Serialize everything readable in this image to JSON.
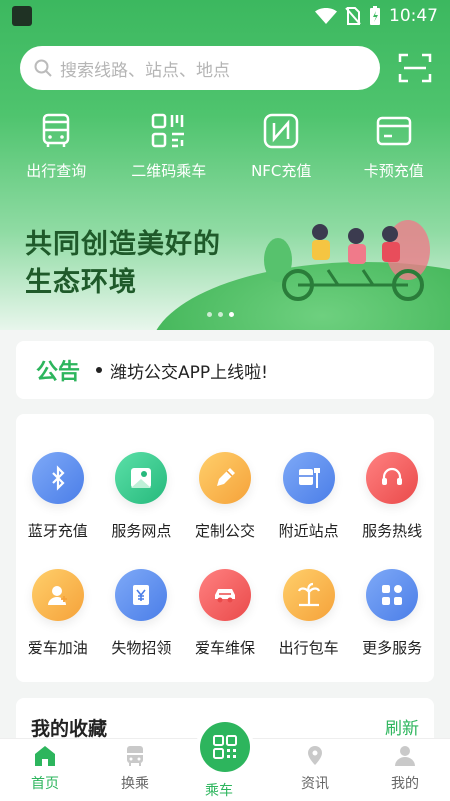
{
  "status": {
    "time": "10:47"
  },
  "search": {
    "placeholder": "搜索线路、站点、地点"
  },
  "quick": [
    {
      "label": "出行查询",
      "icon": "bus-icon"
    },
    {
      "label": "二维码乘车",
      "icon": "qrcode-icon"
    },
    {
      "label": "NFC充值",
      "icon": "nfc-icon"
    },
    {
      "label": "卡预充值",
      "icon": "card-icon"
    }
  ],
  "banner": {
    "line1": "共同创造美好的",
    "line2": "生态环境"
  },
  "notice": {
    "tag": "公告",
    "text": "潍坊公交APP上线啦!"
  },
  "services": [
    {
      "label": "蓝牙充值",
      "icon": "bluetooth-icon",
      "color": "#5b8ff0"
    },
    {
      "label": "服务网点",
      "icon": "map-pin-icon",
      "color": "#37c98c"
    },
    {
      "label": "定制公交",
      "icon": "pencil-icon",
      "color": "#f7b347"
    },
    {
      "label": "附近站点",
      "icon": "bus-stop-icon",
      "color": "#5b8ff0"
    },
    {
      "label": "服务热线",
      "icon": "headset-icon",
      "color": "#f0595a"
    },
    {
      "label": "爱车加油",
      "icon": "fuel-user-icon",
      "color": "#f7b347"
    },
    {
      "label": "失物招领",
      "icon": "yen-bag-icon",
      "color": "#5b8ff0"
    },
    {
      "label": "爱车维保",
      "icon": "car-icon",
      "color": "#f0595a"
    },
    {
      "label": "出行包车",
      "icon": "palm-tree-icon",
      "color": "#f7b347"
    },
    {
      "label": "更多服务",
      "icon": "apps-icon",
      "color": "#5b8ff0"
    }
  ],
  "favorites": {
    "title": "我的收藏",
    "refresh": "刷新"
  },
  "tabs": {
    "home": "首页",
    "transfer": "换乘",
    "ride": "乘车",
    "news": "资讯",
    "mine": "我的"
  }
}
